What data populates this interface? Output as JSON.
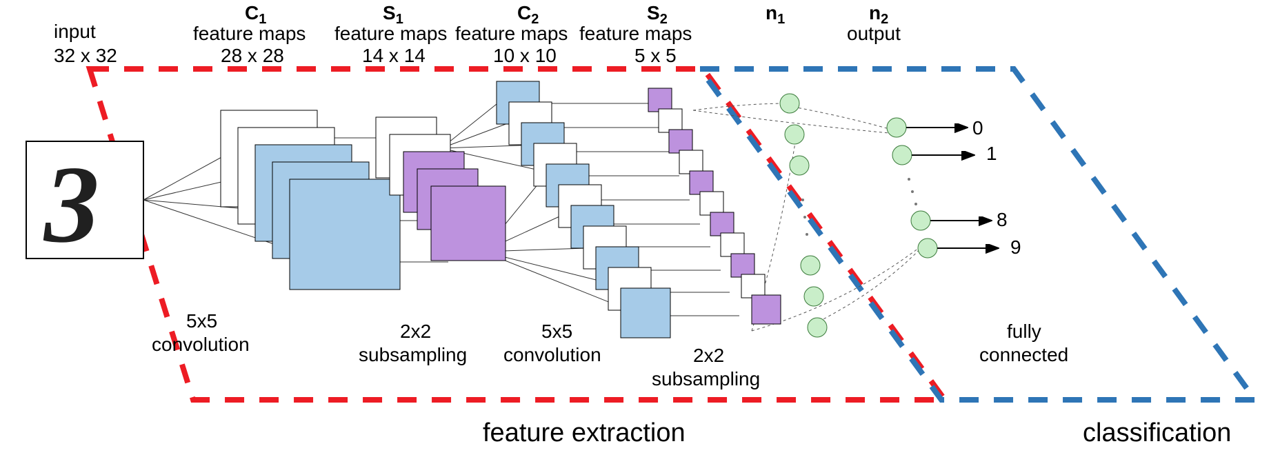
{
  "columns": {
    "input": {
      "title": "input",
      "sub": "32 x 32",
      "bold": ""
    },
    "c1": {
      "bold": "C",
      "boldSub": "1",
      "title": "feature maps",
      "sub": "28 x 28"
    },
    "s1": {
      "bold": "S",
      "boldSub": "1",
      "title": "feature maps",
      "sub": "14 x 14"
    },
    "c2": {
      "bold": "C",
      "boldSub": "2",
      "title": "feature maps",
      "sub": "10 x 10"
    },
    "s2": {
      "bold": "S",
      "boldSub": "2",
      "title": "feature maps",
      "sub": "5 x 5"
    },
    "n1": {
      "bold": "n",
      "boldSub": "1",
      "title": "",
      "sub": ""
    },
    "n2": {
      "bold": "n",
      "boldSub": "2",
      "title": "output",
      "sub": ""
    }
  },
  "ops": {
    "conv1": "5x5\nconvolution",
    "sub1": "2x2\nsubsampling",
    "conv2": "5x5\nconvolution",
    "sub2": "2x2\nsubsampling",
    "fc": "fully\nconnected"
  },
  "regions": {
    "feature": "feature extraction",
    "class": "classification"
  },
  "outputs": {
    "o0": "0",
    "o1": "1",
    "o8": "8",
    "o9": "9"
  },
  "colors": {
    "blue": "#A6CBE8",
    "purple": "#BD92DE",
    "green": "#C9EEC9",
    "stroke": "#000000",
    "dashRed": "#ED1C24",
    "dashBlue": "#2E75B6"
  }
}
